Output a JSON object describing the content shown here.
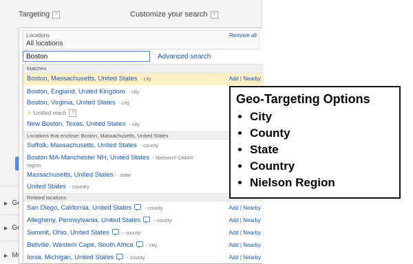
{
  "header": {
    "targeting_label": "Targeting",
    "customize_label": "Customize your search",
    "help_glyph": "?"
  },
  "locations": {
    "label": "Locations",
    "value": "All locations",
    "remove_all": "Remove all"
  },
  "search": {
    "value": "Boston",
    "advanced_link": "Advanced search"
  },
  "dropdown": {
    "matches_header": "Matches",
    "matches": [
      {
        "name": "Boston, Massachusetts, United States",
        "type": "- city",
        "actions": "Add | Nearby"
      },
      {
        "name": "Boston, England, United Kingdom",
        "type": "- city"
      },
      {
        "name": "Boston, Virginia, United States",
        "type": "- city",
        "warning": "Limited reach"
      },
      {
        "name": "New Boston, Texas, United States",
        "type": "- city"
      }
    ],
    "enclose_header": "Locations that enclose: Boston, Massachusetts, United States",
    "enclosing": [
      {
        "name": "Suffolk, Massachusetts, United States",
        "type": "- county"
      },
      {
        "name": "Boston MA-Manchester NH, United States",
        "type": "- Nielsen® DMA®",
        "type2": "region"
      },
      {
        "name": "Massachusetts, United States",
        "type": "- state"
      },
      {
        "name": "United States",
        "type": "- country"
      }
    ],
    "related_header": "Related locations",
    "related": [
      {
        "name": "San Diego, California, United States",
        "type": "- county",
        "actions": "Add | Nearby"
      },
      {
        "name": "Allegheny, Pennsylvania, United States",
        "type": "- county",
        "actions": "Add | Nearby"
      },
      {
        "name": "Summit, Ohio, United States",
        "type": "- county",
        "actions": "Add | Nearby"
      },
      {
        "name": "Bellville, Western Cape, South Africa",
        "type": "- city",
        "actions": "Add | Nearby"
      },
      {
        "name": "Ionia, Michigan, United States",
        "type": "- county",
        "actions": "Add | Nearby"
      }
    ]
  },
  "sidebar": {
    "items": [
      "Ge",
      "Ge",
      "Mu"
    ]
  },
  "callout": {
    "title": "Geo-Targeting Options",
    "items": [
      "City",
      "County",
      "State",
      "Country",
      "Nielson Region"
    ]
  }
}
